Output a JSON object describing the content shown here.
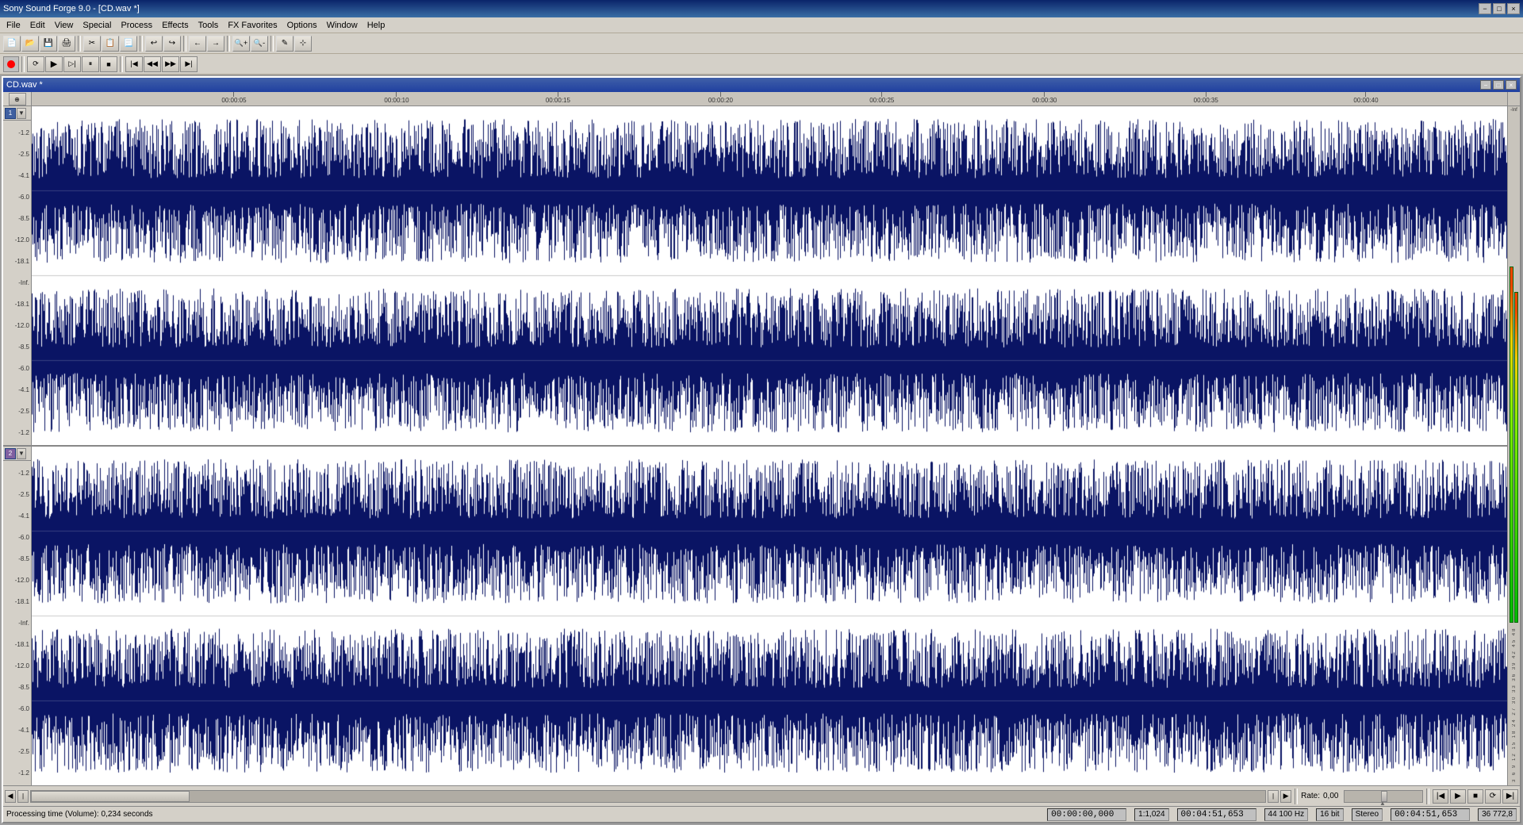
{
  "app": {
    "title": "Sony Sound Forge 9.0 - [CD.wav *]",
    "inner_window_title": "CD.wav *"
  },
  "title_bar": {
    "minimize": "−",
    "maximize": "□",
    "close": "×",
    "restore_inner": "□",
    "close_inner": "×"
  },
  "menu": {
    "items": [
      "File",
      "Edit",
      "View",
      "Special",
      "Process",
      "Effects",
      "Tools",
      "FX Favorites",
      "Options",
      "Window",
      "Help"
    ]
  },
  "toolbar": {
    "buttons": [
      "📄",
      "📂",
      "💾",
      "🖨",
      "⚡",
      "✂",
      "📋",
      "📃",
      "↩",
      "↪",
      "←",
      "→",
      "🔍",
      "🔍",
      "✎",
      "⚡"
    ]
  },
  "transport": {
    "record": "●",
    "loop_record": "⟳",
    "play": "▶",
    "play_sel": "▷",
    "pause": "⏸",
    "stop": "⏹",
    "go_start": "⏮",
    "rewind": "⏪",
    "fast_forward": "⏩",
    "go_end": "⏭"
  },
  "ruler": {
    "marks": [
      {
        "pos_pct": 12.6,
        "label": "00:00:05"
      },
      {
        "pos_pct": 25.3,
        "label": "00:00:10"
      },
      {
        "pos_pct": 37.9,
        "label": "00:00:15"
      },
      {
        "pos_pct": 50.6,
        "label": "00:00:20"
      },
      {
        "pos_pct": 63.2,
        "label": "00:00:25"
      },
      {
        "pos_pct": 75.9,
        "label": "00:00:30"
      },
      {
        "pos_pct": 88.5,
        "label": "00:00:35"
      },
      {
        "pos_pct": 101.0,
        "label": "00:00:40"
      }
    ]
  },
  "track1": {
    "number": "1",
    "db_labels_top": [
      "-1.2",
      "-2.5",
      "-4.1",
      "-6.0",
      "-8.5",
      "-12.0",
      "-18.1",
      "-Inf.",
      "-18.1",
      "-12.0",
      "-8.5",
      "-6.0",
      "-4.1",
      "-2.5",
      "-1.2"
    ]
  },
  "track2": {
    "number": "2",
    "db_labels_top": [
      "-1.2",
      "-2.5",
      "-4.1",
      "-6.0",
      "-8.5",
      "-12.0",
      "-18.1",
      "-Inf.",
      "-18.1",
      "-12.0",
      "-8.5",
      "-6.0",
      "-4.1",
      "-2.5",
      "-1.2"
    ]
  },
  "vu_meter": {
    "labels": [
      "-Inf",
      "3",
      "6",
      "9",
      "12",
      "15",
      "18",
      "24",
      "27",
      "30",
      "33",
      "36",
      "39",
      "42",
      "45",
      "48",
      "51",
      "54",
      "57",
      "60",
      "63",
      "66",
      "69",
      "72",
      "75",
      "78",
      "81",
      "84"
    ]
  },
  "bottom_controls": {
    "rate_label": "Rate:",
    "rate_value": "0,00",
    "pitch_indicator": "▲"
  },
  "status_bar": {
    "processing_time": "Processing time (Volume): 0,234 seconds",
    "sample_rate": "44 100 Hz",
    "bit_depth": "16 bit",
    "channels": "Stereo",
    "duration": "00:04:51,653",
    "samples": "36 772,8",
    "time_cursor": "00:00:00,000",
    "selection_end": "00:04:51,653",
    "zoom": "1:1,024"
  }
}
